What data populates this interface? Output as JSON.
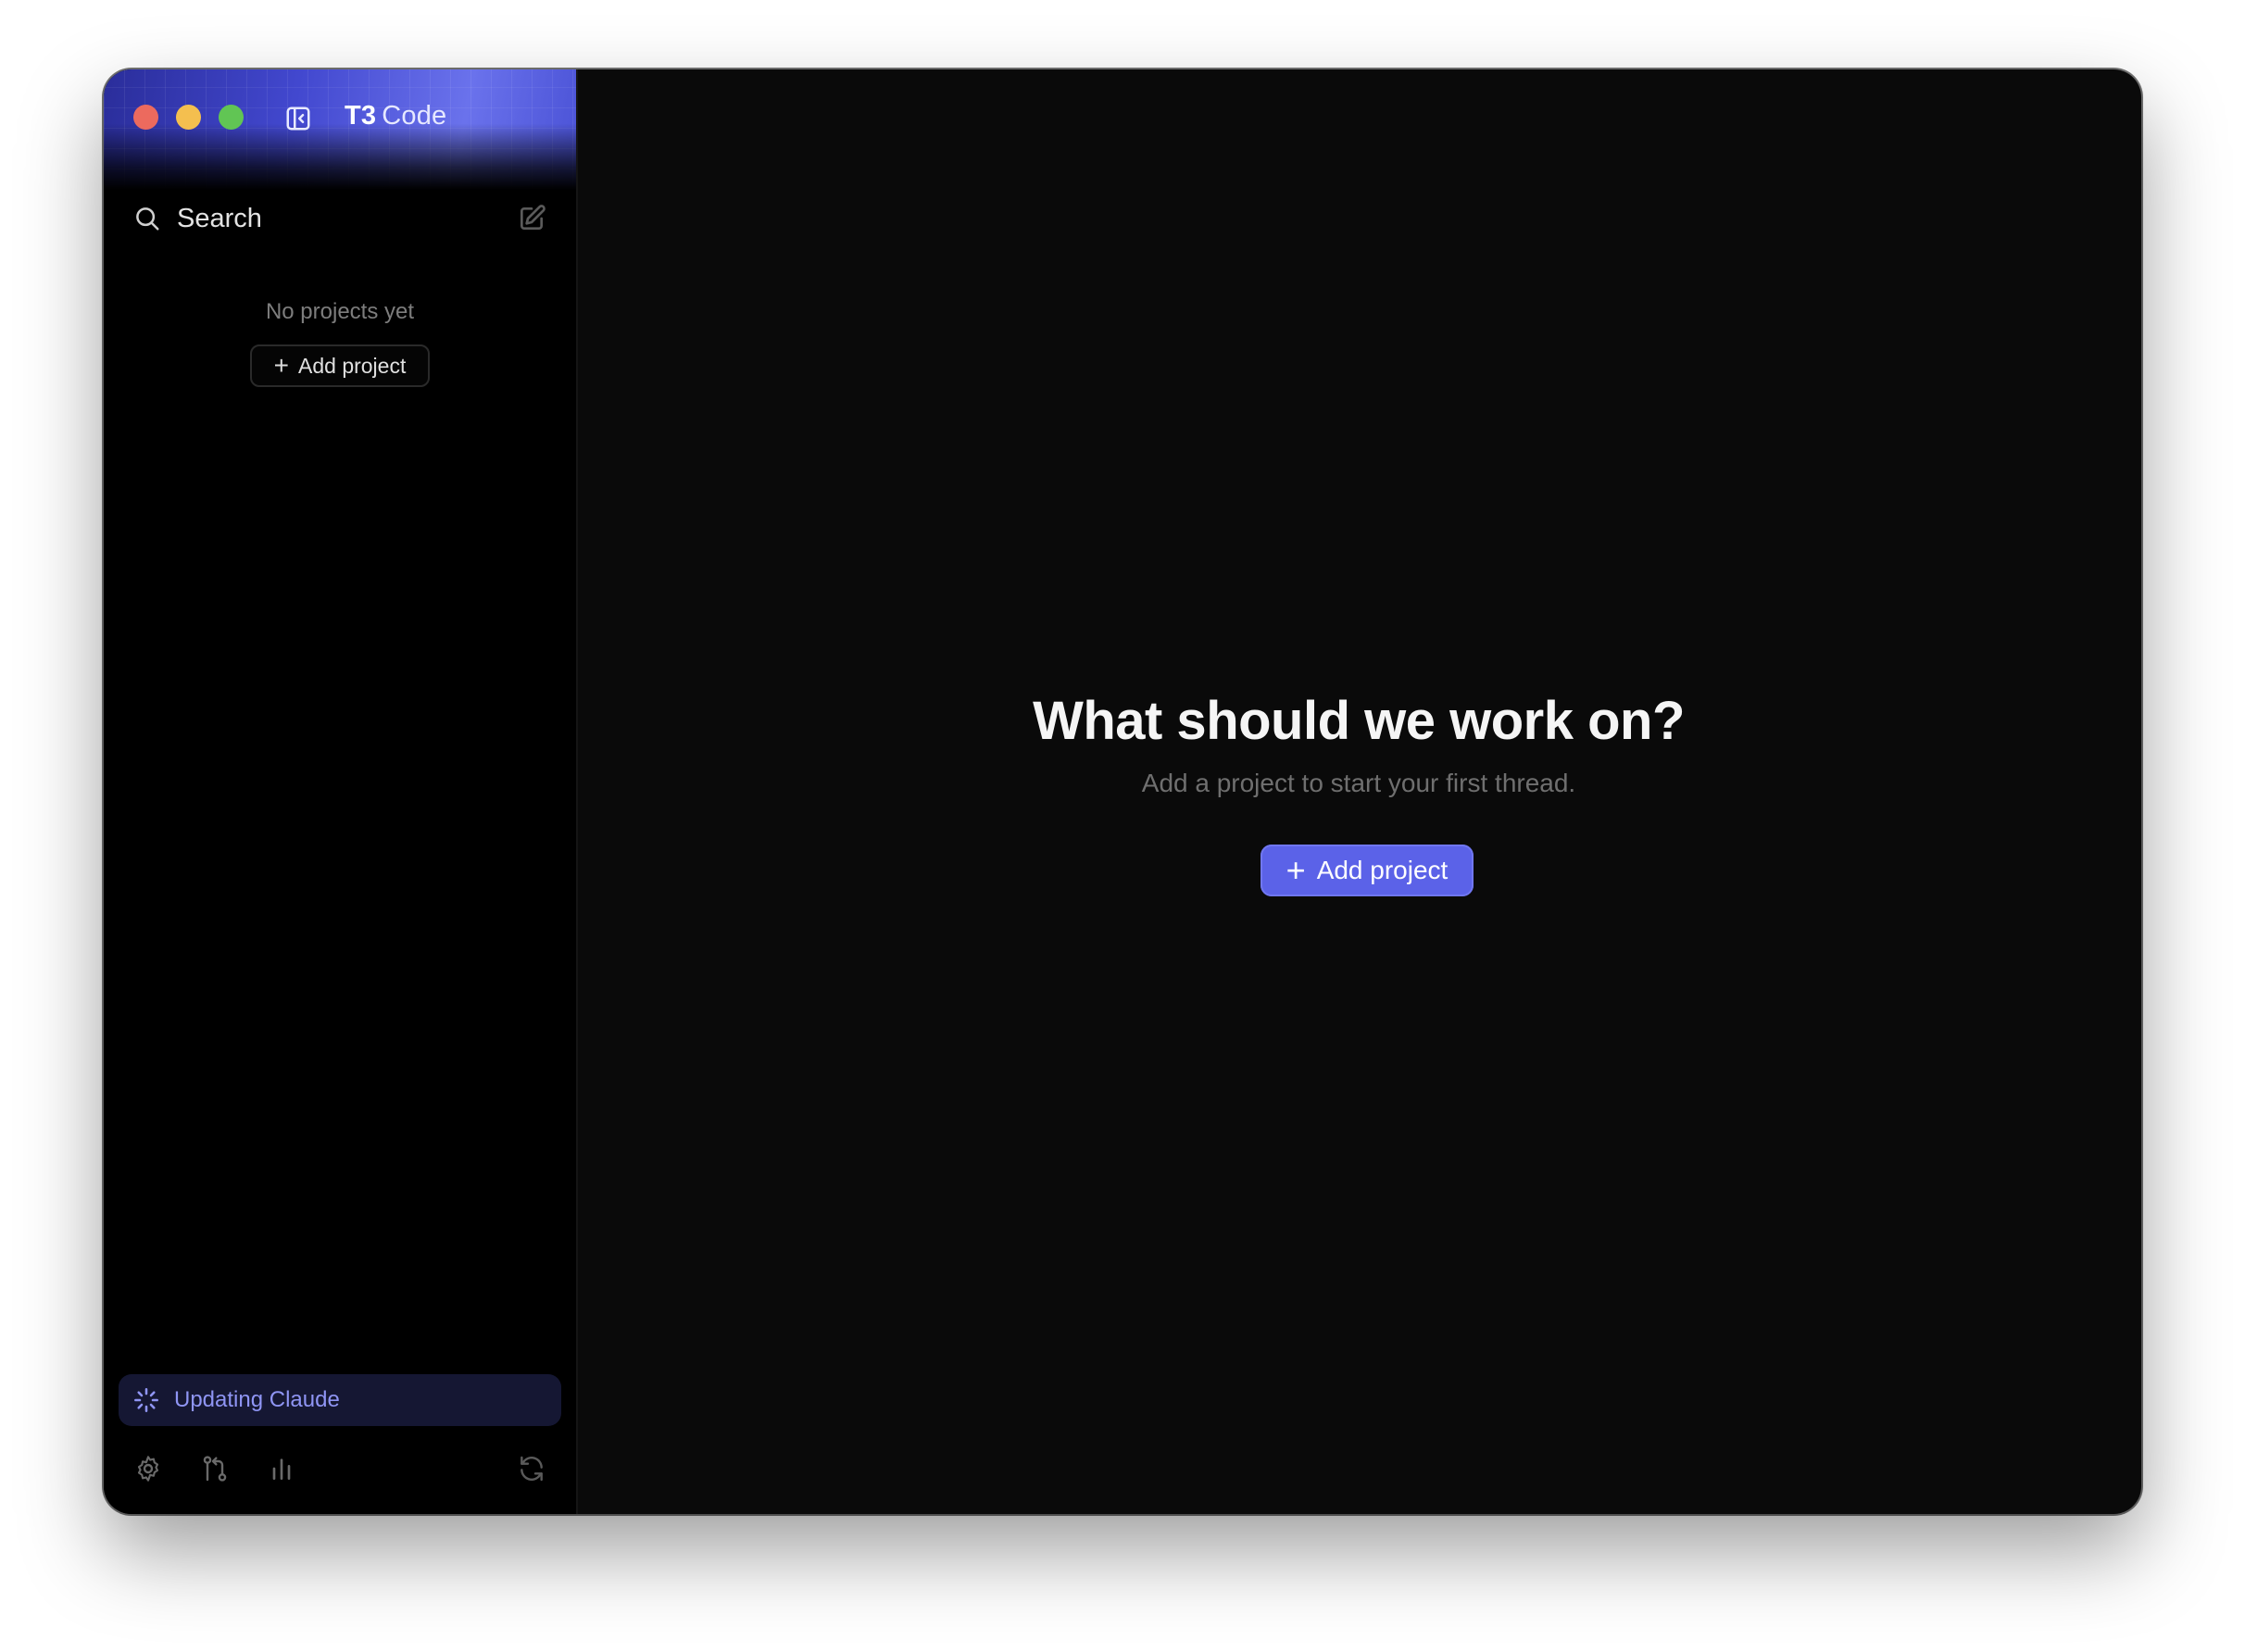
{
  "window": {
    "title_bold": "T3",
    "title_light": "Code"
  },
  "sidebar": {
    "search_label": "Search",
    "empty_message": "No projects yet",
    "add_project_label": "Add project",
    "status_label": "Updating Claude"
  },
  "main": {
    "headline": "What should we work on?",
    "subline": "Add a project to start your first thread.",
    "add_project_label": "Add project"
  },
  "icons": {
    "sidebar_toggle": "sidebar-toggle-icon",
    "search": "search-icon",
    "compose": "compose-icon",
    "loader": "loader-icon",
    "settings": "gear-icon",
    "git": "git-compare-icon",
    "stats": "bar-chart-icon",
    "refresh": "refresh-icon",
    "plus": "plus-icon"
  },
  "colors": {
    "accent": "#5b62e8",
    "status_text": "#8f95f4",
    "status_bg": "#151733",
    "traffic_red": "#ec6a5e",
    "traffic_yellow": "#f4bf4f",
    "traffic_green": "#61c554"
  }
}
